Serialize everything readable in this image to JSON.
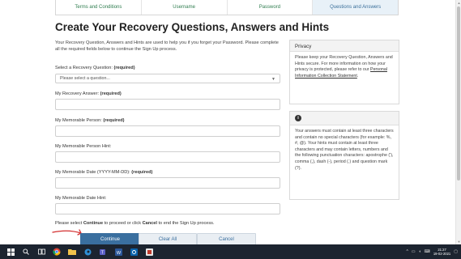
{
  "steps": [
    "Terms and Conditions",
    "Username",
    "Password",
    "Questions and Answers"
  ],
  "title": "Create Your Recovery Questions, Answers and Hints",
  "intro": "Your Recovery Question, Answers and Hints are used to help you if you forget your Password. Please complete all the required fields below to continue the Sign Up process.",
  "form": {
    "question_label": "Select a Recovery Question:",
    "question_required": "(required)",
    "question_placeholder": "Please select a question...",
    "answer_label": "My Recovery Answer:",
    "answer_required": "(required)",
    "answer_value": "",
    "person_label": "My Memorable Person:",
    "person_required": "(required)",
    "person_value": "",
    "person_hint_label": "My Memorable Person Hint:",
    "person_hint_value": "",
    "date_label": "My Memorable Date (YYYY-MM-DD):",
    "date_required": "(required)",
    "date_value": "",
    "date_hint_label": "My Memorable Date Hint:",
    "date_hint_value": ""
  },
  "proceed": {
    "prefix": "Please select ",
    "continue_word": "Continue",
    "middle": " to proceed or click ",
    "cancel_word": "Cancel",
    "suffix": " to end the Sign Up process."
  },
  "buttons": {
    "continue": "Continue",
    "clear_all": "Clear All",
    "cancel": "Cancel"
  },
  "privacy": {
    "heading": "Privacy",
    "text": "Please keep your Recovery Question, Answers and Hints secure. For more information on how your privacy is protected, please refer to our ",
    "link": "Personal Information Collection Statement",
    "end": "."
  },
  "info": {
    "icon": "info-icon",
    "text": "Your answers must contain at least three characters and contain no special characters (for example: %, #, @). Your hints must contain at least three characters and may contain letters, numbers and the following punctuation characters: apostrophe ('), comma (,), dash (-), period (.) and question mark (?)."
  },
  "taskbar": {
    "time": "21:27",
    "date": "19-02-2021"
  },
  "colors": {
    "accent": "#3a6f9f",
    "step_text": "#2f7d4f",
    "taskbar": "#1c2430",
    "annotation": "#d32f2f"
  }
}
